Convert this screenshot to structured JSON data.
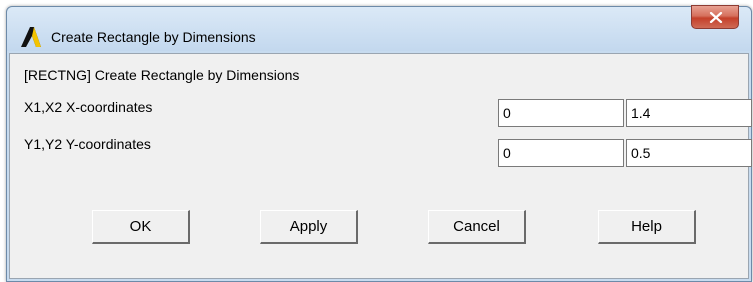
{
  "window": {
    "title": "Create Rectangle by Dimensions",
    "close_label": "x"
  },
  "dialog": {
    "heading": "[RECTNG]  Create Rectangle by Dimensions",
    "rows": [
      {
        "label": "X1,X2  X-coordinates",
        "value1": "0",
        "value2": "1.4"
      },
      {
        "label": "Y1,Y2  Y-coordinates",
        "value1": "0",
        "value2": "0.5"
      }
    ]
  },
  "buttons": {
    "ok": "OK",
    "apply": "Apply",
    "cancel": "Cancel",
    "help": "Help"
  },
  "colors": {
    "titlebar": "#c7dbef",
    "close_button": "#c4402a",
    "client_background": "#f0f0f0"
  }
}
